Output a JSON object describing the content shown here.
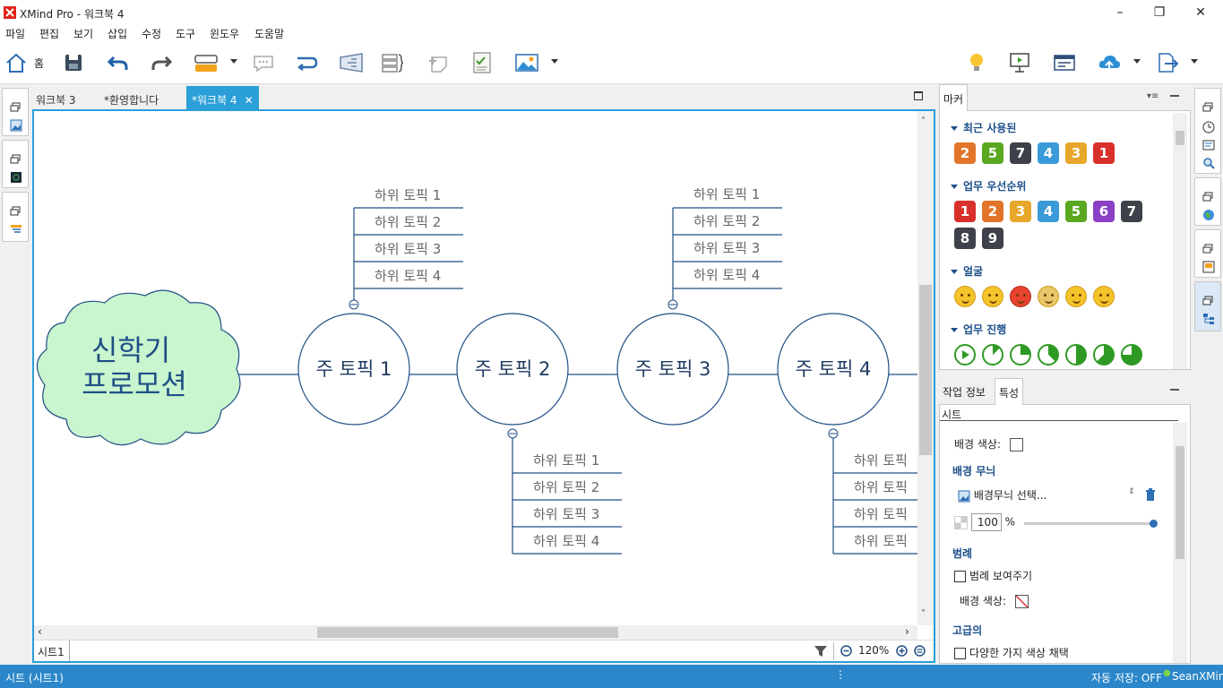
{
  "window": {
    "title": "XMind Pro - 워크북 4"
  },
  "menu": [
    "파일",
    "편집",
    "보기",
    "삽입",
    "수정",
    "도구",
    "윈도우",
    "도움말"
  ],
  "toolbar": {
    "home_label": "홈"
  },
  "editor_tabs": [
    {
      "label": "워크북 3"
    },
    {
      "label": "*환영합니다"
    },
    {
      "label": "*워크북 4"
    }
  ],
  "map": {
    "central_topic_line1": "신학기",
    "central_topic_line2": "프로모션",
    "main_topics": [
      "주 토픽 1",
      "주 토픽 2",
      "주 토픽 3",
      "주 토픽 4"
    ],
    "subtopics": [
      "하위 토픽 1",
      "하위 토픽 2",
      "하위 토픽 3",
      "하위 토픽 4"
    ],
    "subtopics_cut": [
      "하위 토픽",
      "하위 토픽",
      "하위 토픽",
      "하위 토픽"
    ]
  },
  "sheet": {
    "tab": "시트1",
    "zoom": "120%"
  },
  "markers_panel": {
    "tab": "마커",
    "recent": {
      "title": "최근 사용된",
      "items": [
        "2",
        "5",
        "7",
        "4",
        "3",
        "1"
      ]
    },
    "priority": {
      "title": "업무 우선순위",
      "items": [
        "1",
        "2",
        "3",
        "4",
        "5",
        "6",
        "7",
        "8",
        "9"
      ]
    },
    "faces": {
      "title": "얼굴"
    },
    "progress": {
      "title": "업무 진행"
    }
  },
  "properties_panel": {
    "tab_info": "작업 정보",
    "tab_props": "특성",
    "header": "시트",
    "bg_color_label": "배경 색상:",
    "wallpaper_title": "배경 무늬",
    "wallpaper_select": "배경무늬 선택...",
    "opacity_value": "100",
    "opacity_unit": "%",
    "legend_title": "범례",
    "legend_show": "범례 보여주기",
    "legend_bg_label": "배경 색상:",
    "advanced_title": "고급의",
    "multi_color": "다양한 가지 색상 채택"
  },
  "status": {
    "left": "시트 (시트1)",
    "autosave": "자동 저장: OFF",
    "user": "SeanXMind"
  },
  "colors": {
    "accent": "#2b9fd8",
    "statusbar": "#2b87c9",
    "topic_line": "#1f4f85",
    "cloud_fill": "#c9f5cf"
  }
}
